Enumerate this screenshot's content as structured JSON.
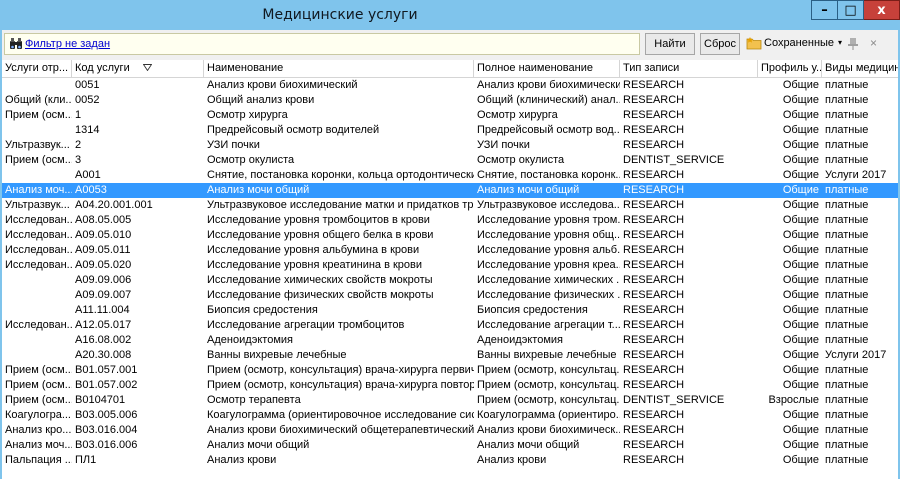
{
  "window": {
    "title": "Медицинские услуги",
    "min_glyph": "–",
    "max_glyph": "□",
    "close_glyph": "x"
  },
  "toolbar": {
    "filter_label": "Фильтр не задан",
    "find_label": "Найти",
    "reset_label": "Сброс",
    "saved_label": "Сохраненные",
    "saved_caret": "▾",
    "clear_glyph": "×",
    "filter_icon": "binoculars-icon",
    "saved_icon": "folder-star-icon",
    "pin_icon": "pin-icon"
  },
  "table": {
    "headers": [
      "Услуги отр...",
      "Код услуги",
      "Наименование",
      "Полное наименование",
      "Тип записи",
      "Профиль у...",
      "Виды медицинс"
    ],
    "selected_row": 7,
    "rows": [
      [
        "",
        "0051",
        "Анализ крови биохимический",
        "Анализ крови биохимический",
        "RESEARCH",
        "Общие",
        "платные"
      ],
      [
        "Общий (кли...",
        "0052",
        "Общий анализ крови",
        "Общий (клинический) анал...",
        "RESEARCH",
        "Общие",
        "платные"
      ],
      [
        "Прием (осм...",
        "1",
        "Осмотр хирурга",
        "Осмотр хирурга",
        "RESEARCH",
        "Общие",
        "платные"
      ],
      [
        "",
        "1314",
        "Предрейсовый осмотр водителей",
        "Предрейсовый осмотр вод...",
        "RESEARCH",
        "Общие",
        "платные"
      ],
      [
        "Ультразвук...",
        "2",
        "УЗИ почки",
        "УЗИ почки",
        "RESEARCH",
        "Общие",
        "платные"
      ],
      [
        "Прием (осм...",
        "3",
        "Осмотр окулиста",
        "Осмотр окулиста",
        "DENTIST_SERVICE",
        "Общие",
        "платные"
      ],
      [
        "",
        "A001",
        "Снятие, постановка коронки, кольца ортодонтических",
        "Снятие, постановка коронк...",
        "RESEARCH",
        "Общие",
        "Услуги 2017"
      ],
      [
        "Анализ моч...",
        "A0053",
        "Анализ мочи общий",
        "Анализ мочи общий",
        "RESEARCH",
        "Общие",
        "платные"
      ],
      [
        "Ультразвук...",
        "A04.20.001.001",
        "Ультразвуковое исследование матки и придатков тра...",
        "Ультразвуковое исследова...",
        "RESEARCH",
        "Общие",
        "платные"
      ],
      [
        "Исследован...",
        "A08.05.005",
        "Исследование уровня тромбоцитов в крови",
        "Исследование уровня тром...",
        "RESEARCH",
        "Общие",
        "платные"
      ],
      [
        "Исследован...",
        "A09.05.010",
        "Исследование уровня общего белка в крови",
        "Исследование уровня общ...",
        "RESEARCH",
        "Общие",
        "платные"
      ],
      [
        "Исследован...",
        "A09.05.011",
        "Исследование уровня альбумина в крови",
        "Исследование уровня альб...",
        "RESEARCH",
        "Общие",
        "платные"
      ],
      [
        "Исследован...",
        "A09.05.020",
        "Исследование уровня креатинина в крови",
        "Исследование уровня креа...",
        "RESEARCH",
        "Общие",
        "платные"
      ],
      [
        "",
        "A09.09.006",
        "Исследование химических свойств мокроты",
        "Исследование химических ...",
        "RESEARCH",
        "Общие",
        "платные"
      ],
      [
        "",
        "A09.09.007",
        "Исследование физических свойств мокроты",
        "Исследование физических ...",
        "RESEARCH",
        "Общие",
        "платные"
      ],
      [
        "",
        "A11.11.004",
        "Биопсия средостения",
        "Биопсия средостения",
        "RESEARCH",
        "Общие",
        "платные"
      ],
      [
        "Исследован...",
        "A12.05.017",
        "Исследование агрегации тромбоцитов",
        "Исследование агрегации т...",
        "RESEARCH",
        "Общие",
        "платные"
      ],
      [
        "",
        "A16.08.002",
        "Аденоидэктомия",
        "Аденоидэктомия",
        "RESEARCH",
        "Общие",
        "платные"
      ],
      [
        "",
        "A20.30.008",
        "Ванны вихревые лечебные",
        "Ванны вихревые лечебные",
        "RESEARCH",
        "Общие",
        "Услуги 2017"
      ],
      [
        "Прием (осм...",
        "B01.057.001",
        "Прием (осмотр, консультация) врача-хирурга первичный",
        "Прием (осмотр, консультац...",
        "RESEARCH",
        "Общие",
        "платные"
      ],
      [
        "Прием (осм...",
        "B01.057.002",
        "Прием (осмотр, консультация) врача-хирурга повторный",
        "Прием (осмотр, консультац...",
        "RESEARCH",
        "Общие",
        "платные"
      ],
      [
        "Прием (осм...",
        "B0104701",
        "Осмотр терапевта",
        "Прием (осмотр, консультац...",
        "DENTIST_SERVICE",
        "Взрослые",
        "платные"
      ],
      [
        "Коагулогра...",
        "B03.005.006",
        "Коагулограмма (ориентировочное исследование сист...",
        "Коагулограмма (ориентиро...",
        "RESEARCH",
        "Общие",
        "платные"
      ],
      [
        "Анализ кро...",
        "B03.016.004",
        "Анализ крови биохимический общетерапевтический",
        "Анализ крови биохимическ...",
        "RESEARCH",
        "Общие",
        "платные"
      ],
      [
        "Анализ моч...",
        "B03.016.006",
        "Анализ мочи общий",
        "Анализ мочи общий",
        "RESEARCH",
        "Общие",
        "платные"
      ],
      [
        "Пальпация ...",
        "ПЛ1",
        "Анализ крови",
        "Анализ крови",
        "RESEARCH",
        "Общие",
        "платные"
      ]
    ]
  }
}
